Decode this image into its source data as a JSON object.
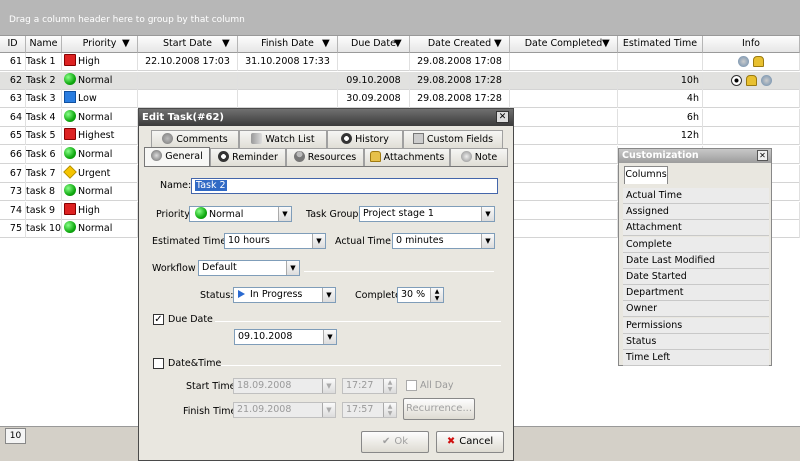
{
  "group_bar": {
    "text": "Drag a column header here to group by that column"
  },
  "columns": [
    {
      "label": "ID",
      "has_filter": false
    },
    {
      "label": "Name",
      "has_filter": false
    },
    {
      "label": "Priority",
      "has_filter": true
    },
    {
      "label": "Start Date",
      "has_filter": true
    },
    {
      "label": "Finish Date",
      "has_filter": true
    },
    {
      "label": "Due Date",
      "has_filter": true
    },
    {
      "label": "Date Created",
      "has_filter": true
    },
    {
      "label": "Date Completed",
      "has_filter": true
    },
    {
      "label": "Estimated Time",
      "has_filter": false
    },
    {
      "label": "Info",
      "has_filter": false
    }
  ],
  "rows": [
    {
      "id": "61",
      "name": "Task 1",
      "priority": "High",
      "priority_icon": "high",
      "start": "22.10.2008 17:03",
      "finish": "31.10.2008 17:33",
      "due": "",
      "created": "29.08.2008 17:08",
      "completed": "",
      "estimated": "",
      "info": "swirl-icon lock-icon"
    },
    {
      "id": "62",
      "name": "Task 2",
      "priority": "Normal",
      "priority_icon": "normal",
      "start": "",
      "finish": "",
      "due": "09.10.2008",
      "created": "29.08.2008 17:28",
      "completed": "",
      "estimated": "10h",
      "info": "eye-icon lock-icon swirl-icon",
      "selected": true
    },
    {
      "id": "63",
      "name": "Task 3",
      "priority": "Low",
      "priority_icon": "low",
      "start": "",
      "finish": "",
      "due": "30.09.2008",
      "created": "29.08.2008 17:28",
      "completed": "",
      "estimated": "4h",
      "info": ""
    },
    {
      "id": "64",
      "name": "Task 4",
      "priority": "Normal",
      "priority_icon": "normal",
      "start": "",
      "finish": "",
      "due": "",
      "created": "",
      "completed": "",
      "estimated": "6h",
      "info": ""
    },
    {
      "id": "65",
      "name": "Task 5",
      "priority": "Highest",
      "priority_icon": "high",
      "start": "",
      "finish": "",
      "due": "",
      "created": "",
      "completed": "",
      "estimated": "12h",
      "info": ""
    },
    {
      "id": "66",
      "name": "Task 6",
      "priority": "Normal",
      "priority_icon": "normal",
      "start": "",
      "finish": "",
      "due": "",
      "created": "",
      "completed": "",
      "estimated": "",
      "info": ""
    },
    {
      "id": "67",
      "name": "Task 7",
      "priority": "Urgent",
      "priority_icon": "urgent",
      "start": "",
      "finish": "",
      "due": "",
      "created": "",
      "completed": "",
      "estimated": "",
      "info": ""
    },
    {
      "id": "73",
      "name": "task 8",
      "priority": "Normal",
      "priority_icon": "normal",
      "start": "",
      "finish": "",
      "due": "",
      "created": "",
      "completed": "",
      "estimated": "",
      "info": ""
    },
    {
      "id": "74",
      "name": "task 9",
      "priority": "High",
      "priority_icon": "high",
      "start": "",
      "finish": "",
      "due": "",
      "created": "",
      "completed": "",
      "estimated": "",
      "info": ""
    },
    {
      "id": "75",
      "name": "task 10",
      "priority": "Normal",
      "priority_icon": "normal",
      "start": "",
      "finish": "",
      "due": "",
      "created": "",
      "completed": "",
      "estimated": "",
      "info": ""
    }
  ],
  "footer": {
    "page_size": "10"
  },
  "dialog": {
    "title": "Edit Task(#62)",
    "close_label": "✕",
    "tabs_row1": [
      "Comments",
      "Watch List",
      "History",
      "Custom Fields"
    ],
    "tabs_row2": [
      "General",
      "Reminder",
      "Resources",
      "Attachments",
      "Note"
    ],
    "active_tab": "General",
    "name_label": "Name:",
    "name_value": "Task 2",
    "priority_label": "Priority:",
    "priority_value": "Normal",
    "task_group_label": "Task Group:",
    "task_group_value": "Project stage 1",
    "estimated_label": "Estimated Time:",
    "estimated_value": "10 hours",
    "actual_label": "Actual Time:",
    "actual_value": "0 minutes",
    "workflow_label": "Workflow",
    "workflow_value": "Default",
    "status_label": "Status:",
    "status_value": "In Progress",
    "complete_label": "Complete:",
    "complete_value": "30 %",
    "due_date_label": "Due Date",
    "due_date_checked": true,
    "due_date_value": "09.10.2008",
    "datetime_label": "Date&Time",
    "datetime_checked": false,
    "start_time_label": "Start Time:",
    "start_date_value": "18.09.2008",
    "start_time_value": "17:27",
    "all_day_label": "All Day",
    "finish_time_label": "Finish Time:",
    "finish_date_value": "21.09.2008",
    "finish_time_value": "17:57",
    "recurrence_label": "Recurrence...",
    "ok_label": "Ok",
    "cancel_label": "Cancel"
  },
  "customization": {
    "title": "Customization",
    "close_label": "✕",
    "tab": "Columns",
    "items": [
      "Actual Time",
      "Assigned",
      "Attachment",
      "Complete",
      "Date Last Modified",
      "Date Started",
      "Department",
      "Owner",
      "Permissions",
      "Status",
      "Time Left"
    ]
  },
  "colors": {
    "selected_row": "#e1e1df",
    "dialog_title": "#3a3a3a",
    "high": "#d22222",
    "normal": "#11aa11",
    "low": "#2a7de0",
    "urgent": "#f5c400"
  }
}
